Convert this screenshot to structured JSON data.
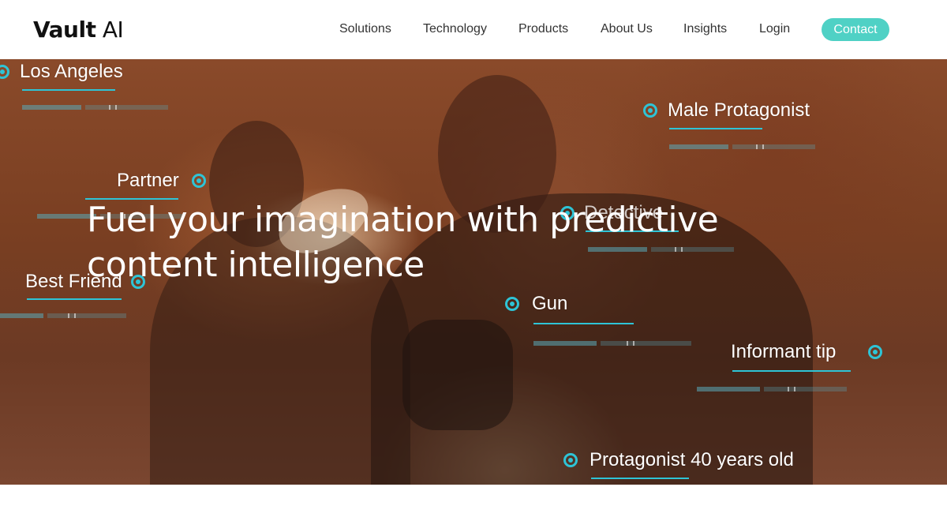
{
  "brand": {
    "logo_bold": "Vault",
    "logo_light": " AI"
  },
  "nav": {
    "items": [
      {
        "label": "Solutions"
      },
      {
        "label": "Technology"
      },
      {
        "label": "Products"
      },
      {
        "label": "About Us"
      },
      {
        "label": "Insights"
      },
      {
        "label": "Login"
      }
    ],
    "contact_label": "Contact"
  },
  "hero": {
    "headline_line1": "Fuel your imagination with predictive",
    "headline_line2": "content intelligence",
    "tags": [
      {
        "label": "Los Angeles"
      },
      {
        "label": "Male Protagonist"
      },
      {
        "label": "Partner"
      },
      {
        "label": "Detective"
      },
      {
        "label": "Best Friend"
      },
      {
        "label": "Gun"
      },
      {
        "label": "Informant tip"
      },
      {
        "label": "Protagonist 40 years old"
      }
    ]
  },
  "colors": {
    "accent": "#4fd1c5",
    "tag_accent": "#2ec4d6"
  },
  "icons": {
    "tag_marker": "target-icon"
  }
}
